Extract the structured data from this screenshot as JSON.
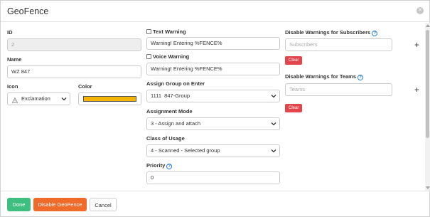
{
  "dialog": {
    "title": "GeoFence"
  },
  "id_field": {
    "label": "ID",
    "value": "2"
  },
  "name_field": {
    "label": "Name",
    "value": "WZ 847"
  },
  "icon_field": {
    "label": "Icon",
    "value": "Exclamation",
    "icon": "warning-triangle-icon"
  },
  "color_field": {
    "label": "Color",
    "value": "#f5b400"
  },
  "text_warning": {
    "label": "Text Warning",
    "checked": false,
    "value": "Warning! Entering %FENCE%"
  },
  "voice_warning": {
    "label": "Voice Warning",
    "checked": false,
    "value": "Warning! Entering %FENCE%"
  },
  "assign_group": {
    "label": "Assign Group on Enter",
    "value": "1111  847-Group"
  },
  "assignment_mode": {
    "label": "Assignment Mode",
    "value": "3 - Assign and attach"
  },
  "class_of_usage": {
    "label": "Class of Usage",
    "value": "4 - Scanned - Selected group"
  },
  "priority": {
    "label": "Priority",
    "value": "0"
  },
  "disable_subscribers": {
    "label": "Disable Warnings for Subscribers",
    "placeholder": "Subscribers",
    "clear_label": "Clear",
    "add_label": "+"
  },
  "disable_teams": {
    "label": "Disable Warnings for Teams",
    "placeholder": "Teams",
    "clear_label": "Clear",
    "add_label": "+"
  },
  "footer": {
    "done_label": "Done",
    "disable_label": "Disable GeoFence",
    "cancel_label": "Cancel"
  },
  "colors": {
    "done": "#3fbf7f",
    "disable": "#f06a2a",
    "clear": "#e2454a",
    "info": "#2a7fd4"
  }
}
